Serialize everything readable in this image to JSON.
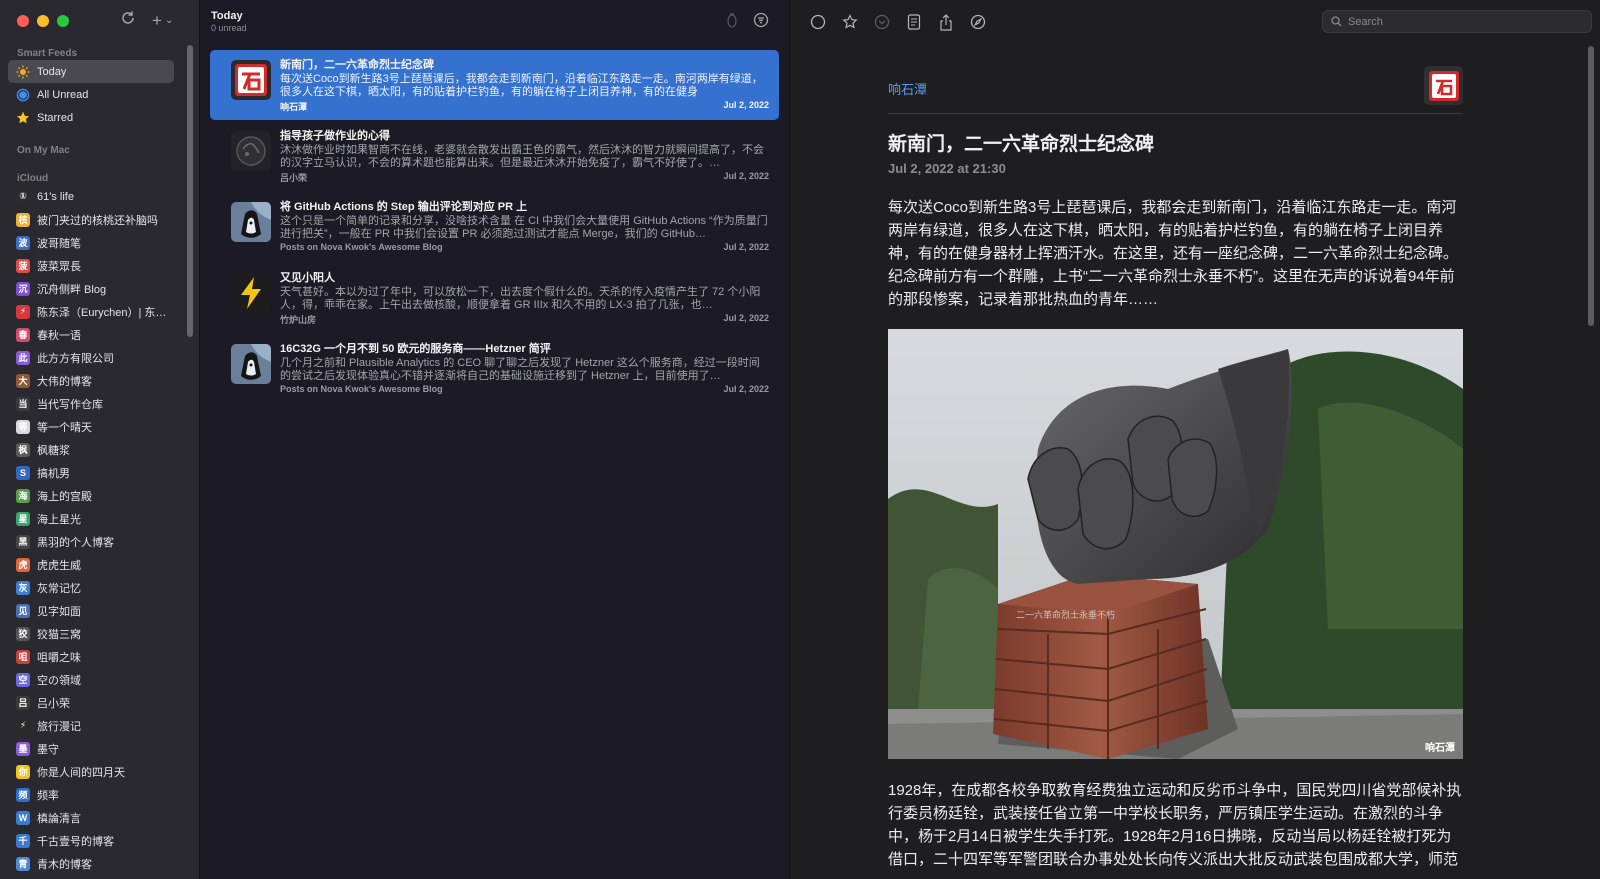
{
  "sidebar": {
    "smart_feeds_heading": "Smart Feeds",
    "smart_feeds": [
      {
        "label": "Today",
        "icon": "sun-icon",
        "selected": true
      },
      {
        "label": "All Unread",
        "icon": "circle-icon"
      },
      {
        "label": "Starred",
        "icon": "star-icon"
      }
    ],
    "on_my_mac_heading": "On My Mac",
    "icloud_heading": "iCloud",
    "feeds": [
      {
        "label": "61's life",
        "color": "#2b2b2b",
        "glyph": "①"
      },
      {
        "label": "被门夹过的核桃还补脑吗",
        "color": "#e8b339",
        "glyph": "核"
      },
      {
        "label": "波哥随笔",
        "color": "#3a6fc4",
        "glyph": "波"
      },
      {
        "label": "菠菜眾長",
        "color": "#e24a4a",
        "glyph": "菠"
      },
      {
        "label": "沉舟侧畔 Blog",
        "color": "#7b4fcf",
        "glyph": "沉"
      },
      {
        "label": "陈东泽（Eurychen）| 东…",
        "color": "#d9363e",
        "glyph": "⚡"
      },
      {
        "label": "春秋一语",
        "color": "#d44a6a",
        "glyph": "春"
      },
      {
        "label": "此方方有限公司",
        "color": "#8a5bd6",
        "glyph": "此"
      },
      {
        "label": "大伟的博客",
        "color": "#8c5a36",
        "glyph": "大"
      },
      {
        "label": "当代写作仓库",
        "color": "#3a3a3a",
        "glyph": "当"
      },
      {
        "label": "等一个晴天",
        "color": "#d8d8d8",
        "glyph": "等"
      },
      {
        "label": "枫糖浆",
        "color": "#5a5a5a",
        "glyph": "枫"
      },
      {
        "label": "搞机男",
        "color": "#3567c2",
        "glyph": "S"
      },
      {
        "label": "海上的宫殿",
        "color": "#5c9c4d",
        "glyph": "海"
      },
      {
        "label": "海上星光",
        "color": "#3aa569",
        "glyph": "星"
      },
      {
        "label": "黑羽的个人博客",
        "color": "#444",
        "glyph": "黑"
      },
      {
        "label": "虎虎生威",
        "color": "#e0663a",
        "glyph": "虎"
      },
      {
        "label": "灰常记忆",
        "color": "#3c7fd6",
        "glyph": "灰"
      },
      {
        "label": "见字如面",
        "color": "#4a6fb8",
        "glyph": "见"
      },
      {
        "label": "狡猫三窝",
        "color": "#555",
        "glyph": "狡"
      },
      {
        "label": "咀嚼之味",
        "color": "#c73f3f",
        "glyph": "咀"
      },
      {
        "label": "空の領域",
        "color": "#6b6be0",
        "glyph": "空"
      },
      {
        "label": "吕小荣",
        "color": "#3a3a3a",
        "glyph": "吕"
      },
      {
        "label": "旅行漫记",
        "color": "#2a2a2a",
        "glyph": "⚡"
      },
      {
        "label": "墨守",
        "color": "#8a5bd6",
        "glyph": "墨"
      },
      {
        "label": "你是人间的四月天",
        "color": "#f0c419",
        "glyph": "你"
      },
      {
        "label": "频率",
        "color": "#2d6fd0",
        "glyph": "频"
      },
      {
        "label": "槙論清言",
        "color": "#3b7ad0",
        "glyph": "W"
      },
      {
        "label": "千古壹号的博客",
        "color": "#3b7ad0",
        "glyph": "千"
      },
      {
        "label": "青木的博客",
        "color": "#4a8ad8",
        "glyph": "青"
      }
    ]
  },
  "toolbar_left": {
    "refresh_icon": "refresh-icon",
    "add_icon": "plus-icon",
    "plus_glyph": "+",
    "chevron_glyph": "⌄"
  },
  "timeline": {
    "title": "Today",
    "subtitle": "0 unread",
    "articles": [
      {
        "title": "新南门，二一六革命烈士纪念碑",
        "summary": "每次送Coco到新生路3号上琵琶课后，我都会走到新南门，沿着临江东路走一走。南河两岸有绿道，很多人在这下棋，晒太阳，有的贴着护栏钓鱼，有的躺在椅子上闭目养神，有的在健身",
        "feed": "响石潭",
        "date": "Jul 2, 2022",
        "selected": true
      },
      {
        "title": "指导孩子做作业的心得",
        "summary": "沐沐做作业时如果智商不在线，老婆就会散发出霸王色的霸气，然后沐沐的智力就瞬间提高了，不会的汉字立马认识，不会的算术题也能算出来。但是最近沐沐开始免疫了，霸气不好使了。…",
        "feed": "吕小荣",
        "date": "Jul 2, 2022"
      },
      {
        "title": "将 GitHub Actions 的 Step 输出评论到对应 PR 上",
        "summary": "这个只是一个简单的记录和分享，没啥技术含量 在 CI 中我们会大量使用 GitHub Actions “作为质量门进行把关”，一般在 PR 中我们会设置 PR 必须跑过测试才能点 Merge，我们的 GitHub…",
        "feed": "Posts on Nova Kwok's Awesome Blog",
        "date": "Jul 2, 2022"
      },
      {
        "title": "又见小阳人",
        "summary": "天气甚好。本以为过了年中，可以放松一下，出去度个假什么的。天杀的传入疫情产生了 72 个小阳人，得，乖乖在家。上午出去做核酸，顺便拿着 GR IIIx 和久不用的 LX-3 拍了几张，也…",
        "feed": "竹炉山房",
        "date": "Jul 2, 2022"
      },
      {
        "title": "16C32G 一个月不到 50 欧元的服务商——Hetzner 简评",
        "summary": "几个月之前和 Plausible Analytics 的 CEO 聊了聊之后发现了 Hetzner 这么个服务商，经过一段时间的尝试之后发现体验真心不错并逐渐将自己的基础设施迁移到了 Hetzner 上，目前使用了…",
        "feed": "Posts on Nova Kwok's Awesome Blog",
        "date": "Jul 2, 2022"
      }
    ]
  },
  "reader": {
    "search_placeholder": "Search",
    "feed_name": "响石潭",
    "title": "新南门，二一六革命烈士纪念碑",
    "date": "Jul 2, 2022 at 21:30",
    "para1": "每次送Coco到新生路3号上琵琶课后，我都会走到新南门，沿着临江东路走一走。南河两岸有绿道，很多人在这下棋，晒太阳，有的贴着护栏钓鱼，有的躺在椅子上闭目养神，有的在健身器材上挥洒汗水。在这里，还有一座纪念碑，二一六革命烈士纪念碑。纪念碑前方有一个群雕，上书“二一六革命烈士永垂不朽”。这里在无声的诉说着94年前的那段惨案，记录着那批热血的青年……",
    "image_caption": "响石潭",
    "image_inscription": "二一六革命烈士永垂不朽",
    "para2": "1928年，在成都各校争取教育经费独立运动和反劣币斗争中，国民党四川省党部候补执行委员杨廷铨，武装接任省立第一中学校长职务，严厉镇压学生运动。在激烈的斗争中，杨于2月14日被学生失手打死。1928年2月16日拂晓，反动当局以杨廷铨被打死为借口，二十四军等军警团联合办事处处长向传义派出大批反动武装包围成都大学，师范"
  },
  "colors": {
    "accent": "#3572d0",
    "link": "#5b9cf5"
  }
}
